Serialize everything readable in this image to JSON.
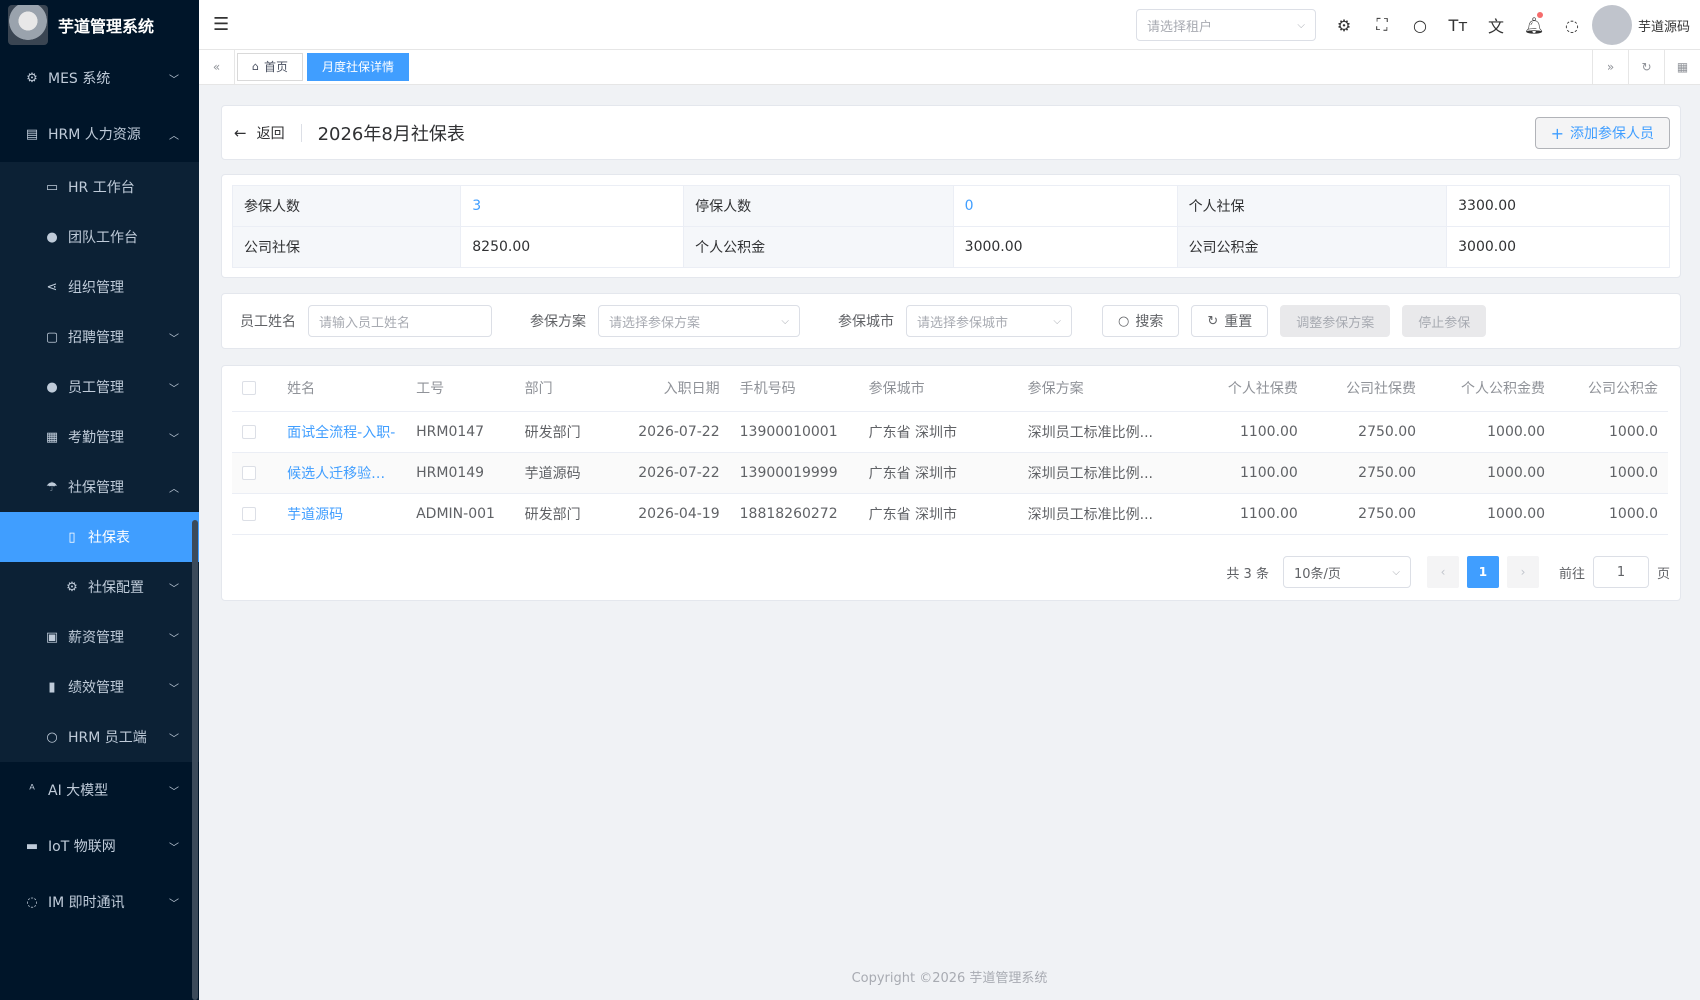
{
  "app": {
    "title": "芋道管理系统"
  },
  "sidebar": {
    "items": [
      {
        "label": "MES 系统",
        "level": 0,
        "icon": "cpu-icon",
        "arrow": "down"
      },
      {
        "label": "HRM 人力资源",
        "level": 0,
        "icon": "building-icon",
        "arrow": "up"
      },
      {
        "label": "HR 工作台",
        "level": 1,
        "icon": "monitor-icon"
      },
      {
        "label": "团队工作台",
        "level": 1,
        "icon": "user-icon"
      },
      {
        "label": "组织管理",
        "level": 1,
        "icon": "share-icon"
      },
      {
        "label": "招聘管理",
        "level": 1,
        "icon": "briefcase-icon",
        "arrow": "down"
      },
      {
        "label": "员工管理",
        "level": 1,
        "icon": "user-icon",
        "arrow": "down"
      },
      {
        "label": "考勤管理",
        "level": 1,
        "icon": "calendar-icon",
        "arrow": "down"
      },
      {
        "label": "社保管理",
        "level": 1,
        "icon": "umbrella-icon",
        "arrow": "up"
      },
      {
        "label": "社保表",
        "level": 2,
        "icon": "document-icon",
        "active": true
      },
      {
        "label": "社保配置",
        "level": 2,
        "icon": "gear-icon",
        "arrow": "down"
      },
      {
        "label": "薪资管理",
        "level": 1,
        "icon": "wallet-icon",
        "arrow": "down"
      },
      {
        "label": "绩效管理",
        "level": 1,
        "icon": "bar-chart-icon",
        "arrow": "down"
      },
      {
        "label": "HRM 员工端",
        "level": 1,
        "icon": "person-icon",
        "arrow": "down"
      },
      {
        "label": "AI 大模型",
        "level": 0,
        "icon": "ai-icon",
        "arrow": "down"
      },
      {
        "label": "IoT 物联网",
        "level": 0,
        "icon": "car-icon",
        "arrow": "down"
      },
      {
        "label": "IM 即时通讯",
        "level": 0,
        "icon": "chat-icon",
        "arrow": "down"
      }
    ]
  },
  "header": {
    "tenant_placeholder": "请选择租户",
    "user_name": "芋道源码"
  },
  "tags": [
    {
      "label": "首页",
      "active": false
    },
    {
      "label": "月度社保详情",
      "active": true
    }
  ],
  "page": {
    "back_label": "返回",
    "title": "2026年8月社保表",
    "add_button": "添加参保人员"
  },
  "summary": {
    "rows": [
      [
        {
          "label": "参保人数",
          "value": "3",
          "link": true
        },
        {
          "label": "停保人数",
          "value": "0",
          "link": true
        },
        {
          "label": "个人社保",
          "value": "3300.00"
        }
      ],
      [
        {
          "label": "公司社保",
          "value": "8250.00"
        },
        {
          "label": "个人公积金",
          "value": "3000.00"
        },
        {
          "label": "公司公积金",
          "value": "3000.00"
        }
      ]
    ]
  },
  "filter": {
    "name_label": "员工姓名",
    "name_placeholder": "请输入员工姓名",
    "plan_label": "参保方案",
    "plan_placeholder": "请选择参保方案",
    "city_label": "参保城市",
    "city_placeholder": "请选择参保城市",
    "search": "搜索",
    "reset": "重置",
    "adjust": "调整参保方案",
    "stop": "停止参保"
  },
  "table": {
    "columns": [
      "姓名",
      "工号",
      "部门",
      "入职日期",
      "手机号码",
      "参保城市",
      "参保方案",
      "个人社保费",
      "公司社保费",
      "个人公积金费",
      "公司公积金"
    ],
    "rows": [
      [
        "面试全流程-入职-",
        "HRM0147",
        "研发部门",
        "2026-07-22",
        "13900010001",
        "广东省 深圳市",
        "深圳员工标准比例...",
        "1100.00",
        "2750.00",
        "1000.00",
        "1000.0"
      ],
      [
        "候选人迁移验收-0",
        "HRM0149",
        "芋道源码",
        "2026-07-22",
        "13900019999",
        "广东省 深圳市",
        "深圳员工标准比例...",
        "1100.00",
        "2750.00",
        "1000.00",
        "1000.0"
      ],
      [
        "芋道源码",
        "ADMIN-001",
        "研发部门",
        "2026-04-19",
        "18818260272",
        "广东省 深圳市",
        "深圳员工标准比例...",
        "1100.00",
        "2750.00",
        "1000.00",
        "1000.0"
      ]
    ]
  },
  "pager": {
    "total": "共 3 条",
    "page_size": "10条/页",
    "current": "1",
    "goto_label": "前往",
    "goto_value": "1",
    "page_suffix": "页"
  },
  "footer": {
    "copyright": "Copyright ©2026 芋道管理系统"
  }
}
